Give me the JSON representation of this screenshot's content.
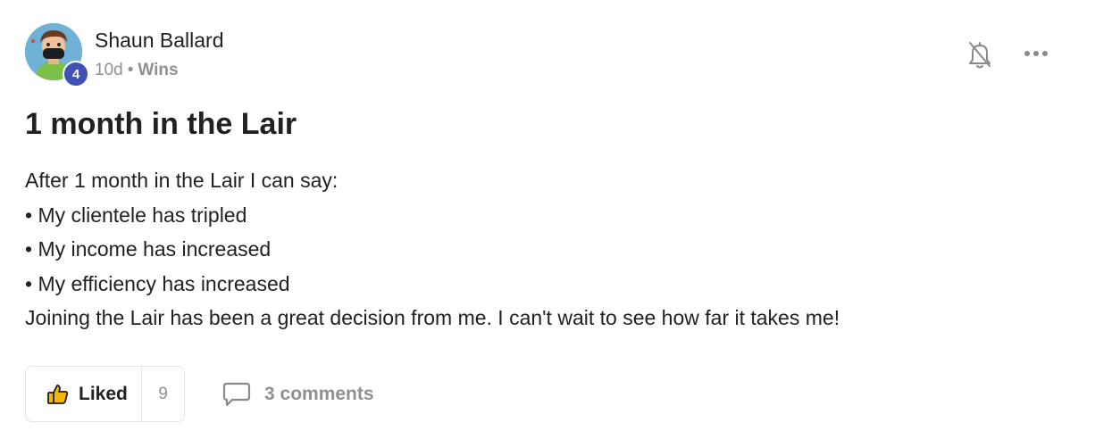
{
  "post": {
    "author": {
      "name": "Shaun Ballard",
      "level": "4",
      "avatar_icon": "cartoon-avatar-with-mask"
    },
    "meta": {
      "time": "10d",
      "separator": "•",
      "category": "Wins"
    },
    "title": "1 month in the Lair",
    "body_lines": [
      "After 1 month in the Lair I can say:",
      "• My clientele has tripled",
      "• My income has increased",
      "• My efficiency has increased",
      "Joining the Lair has been a great decision from me. I can't wait to see how far it takes me!"
    ],
    "actions": {
      "like_label": "Liked",
      "like_count": "9",
      "comments_label": "3 comments"
    },
    "icons": {
      "notification": "bell-off-icon",
      "more": "more-horizontal-icon",
      "like": "thumbs-up-icon",
      "comment": "comment-icon"
    },
    "colors": {
      "level_badge": "#3f51b5",
      "muted_text": "#909090",
      "like_icon": "#f5b800"
    }
  }
}
